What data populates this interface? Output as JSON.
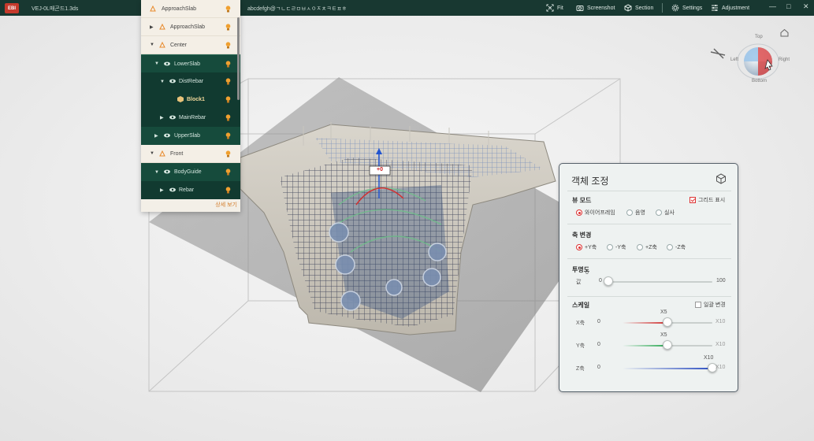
{
  "titlebar": {
    "logo_text": "EBI",
    "file_name": "VEJ-0L매곤드1.3ds",
    "scene_path": "abcdefgh@ㄱㄴㄷㄹㅁㅂㅅㅇㅈㅊㅋㅌㅍㅎ",
    "tools": [
      {
        "label": "Fit",
        "icon": "fit-icon"
      },
      {
        "label": "Screenshot",
        "icon": "camera-icon"
      },
      {
        "label": "Section",
        "icon": "section-cube-icon"
      },
      {
        "label": "Settings",
        "icon": "gear-icon"
      },
      {
        "label": "Adjustment",
        "icon": "sliders-icon"
      }
    ],
    "window_controls": [
      "—",
      "□",
      "✕"
    ]
  },
  "colors": {
    "titlebar": "#183831",
    "tree_dark": "#164b3c",
    "tree_light": "#f4efe6",
    "accent_orange": "#e8892b",
    "radio_on": "#d33333",
    "axis_x": "#d03030",
    "axis_y": "#2aa852",
    "axis_z": "#2d4fc2"
  },
  "tree": {
    "items": [
      {
        "label": "ApproachSlab",
        "icon": "triangle-node-icon",
        "twisty": ""
      },
      {
        "label": "ApproachSlab",
        "icon": "triangle-node-icon",
        "twisty": "▶"
      },
      {
        "label": "Center",
        "icon": "triangle-node-icon",
        "twisty": "▼"
      },
      {
        "label": "LowerSlab",
        "icon": "eye-icon",
        "twisty": "▼"
      },
      {
        "label": "DistRebar",
        "icon": "eye-icon",
        "twisty": "▼"
      },
      {
        "label": "Block1",
        "icon": "block-icon",
        "twisty": ""
      },
      {
        "label": "MainRebar",
        "icon": "eye-icon",
        "twisty": "▶"
      },
      {
        "label": "UpperSlab",
        "icon": "eye-icon",
        "twisty": "▶"
      },
      {
        "label": "Front",
        "icon": "triangle-node-icon",
        "twisty": "▼"
      },
      {
        "label": "BodyGuide",
        "icon": "eye-icon",
        "twisty": "▼"
      },
      {
        "label": "Rebar",
        "icon": "eye-icon",
        "twisty": "▶"
      }
    ],
    "detail_link": "상세 보기"
  },
  "gizmo": {
    "top": "Top",
    "left": "Left",
    "right": "Right",
    "bottom": "Bottom"
  },
  "viewport": {
    "axis_value": "+0"
  },
  "panel": {
    "title": "객체 조정",
    "view_mode": {
      "title": "뷰 모드",
      "grid_label": "그리드 표시",
      "grid_checked": true,
      "options": [
        "와이어프레임",
        "음영",
        "실사"
      ],
      "selected": 0
    },
    "axis_change": {
      "title": "축 변경",
      "options": [
        "+Y축",
        "-Y축",
        "+Z축",
        "-Z축"
      ],
      "selected": 0
    },
    "transparency": {
      "title": "투명도",
      "label": "값",
      "min": "0",
      "max": "100",
      "value": "0",
      "fraction": 0
    },
    "scale": {
      "title": "스케일",
      "uniform_label": "일괄 변경",
      "uniform_checked": false,
      "rows": [
        {
          "axis": "X축",
          "min": "0",
          "max": "X10",
          "value": "X5",
          "fraction": 0.5
        },
        {
          "axis": "Y축",
          "min": "0",
          "max": "X10",
          "value": "X5",
          "fraction": 0.5
        },
        {
          "axis": "Z축",
          "min": "0",
          "max": "X10",
          "value": "X10",
          "fraction": 1.0
        }
      ]
    }
  }
}
